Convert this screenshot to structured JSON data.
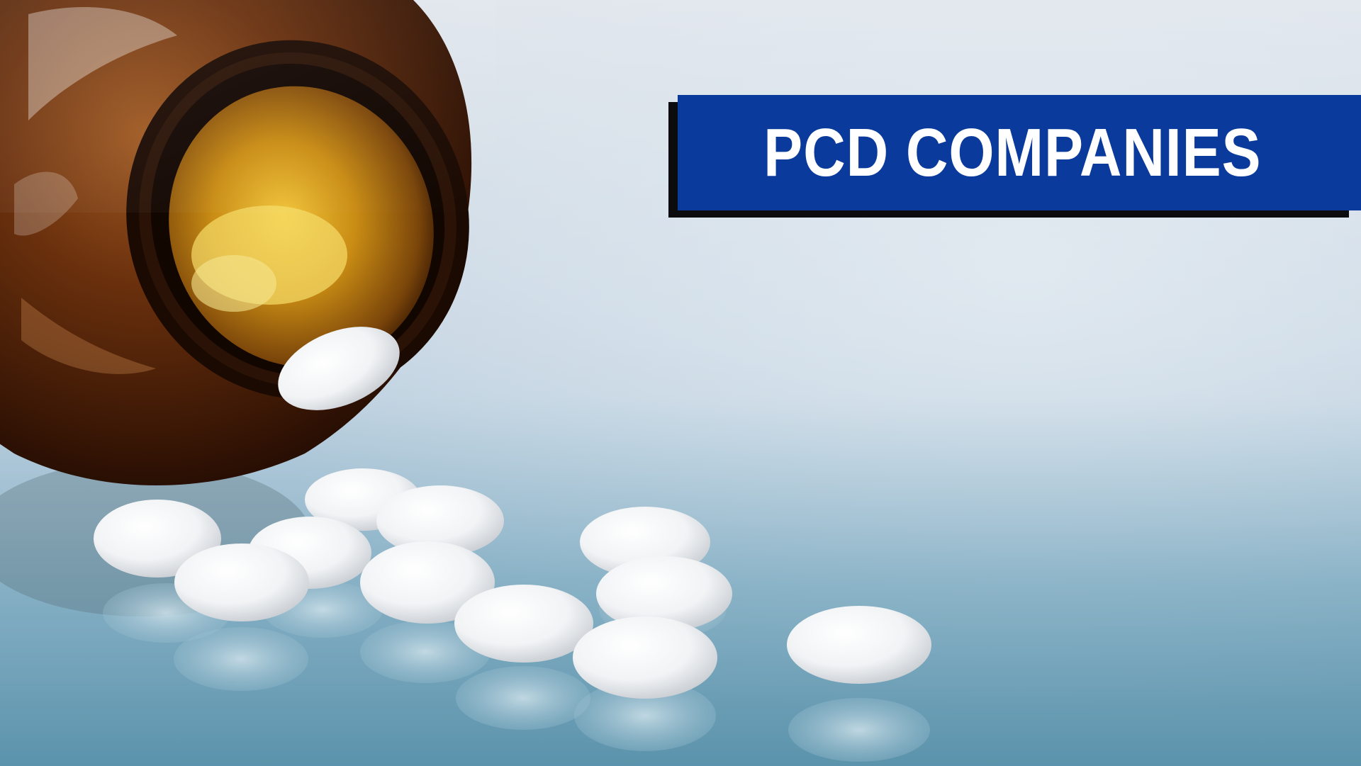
{
  "banner": {
    "title": "PCD COMPANIES",
    "background_color": "#0a3a9c",
    "text_color": "#ffffff",
    "shadow_color": "#0c0c0e"
  },
  "photo": {
    "pill_color": "#ffffff",
    "bottle_color": "#5a2a0c",
    "background_color": "#cbd8e3"
  }
}
